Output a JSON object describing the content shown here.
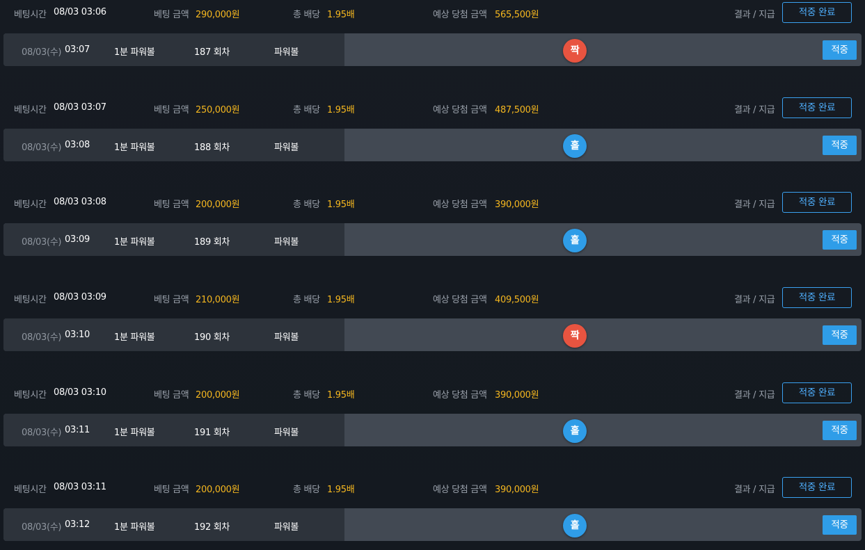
{
  "labels": {
    "bet_time": "베팅시간",
    "bet_amount": "베팅 금액",
    "total_odds": "총 배당",
    "expected_win": "예상 당첨 금액",
    "result_pay": "결과 / 지급",
    "hit_done": "적중 완료",
    "hit": "적중"
  },
  "colors": {
    "odd_ball": "#2f9de8",
    "even_ball": "#e85440",
    "accent_gold": "#f5b71f",
    "button_blue": "#2f9de8"
  },
  "bets": [
    {
      "bet_time": "08/03 03:06",
      "amount": "290,000원",
      "odds": "1.95배",
      "expected": "565,500원",
      "date": "08/03(수)",
      "time": "03:07",
      "game": "1분 파워볼",
      "round": "187 회차",
      "type": "파워볼",
      "pick": "짝",
      "pick_color": "#e85440"
    },
    {
      "bet_time": "08/03 03:07",
      "amount": "250,000원",
      "odds": "1.95배",
      "expected": "487,500원",
      "date": "08/03(수)",
      "time": "03:08",
      "game": "1분 파워볼",
      "round": "188 회차",
      "type": "파워볼",
      "pick": "홀",
      "pick_color": "#2f9de8"
    },
    {
      "bet_time": "08/03 03:08",
      "amount": "200,000원",
      "odds": "1.95배",
      "expected": "390,000원",
      "date": "08/03(수)",
      "time": "03:09",
      "game": "1분 파워볼",
      "round": "189 회차",
      "type": "파워볼",
      "pick": "홀",
      "pick_color": "#2f9de8"
    },
    {
      "bet_time": "08/03 03:09",
      "amount": "210,000원",
      "odds": "1.95배",
      "expected": "409,500원",
      "date": "08/03(수)",
      "time": "03:10",
      "game": "1분 파워볼",
      "round": "190 회차",
      "type": "파워볼",
      "pick": "짝",
      "pick_color": "#e85440"
    },
    {
      "bet_time": "08/03 03:10",
      "amount": "200,000원",
      "odds": "1.95배",
      "expected": "390,000원",
      "date": "08/03(수)",
      "time": "03:11",
      "game": "1분 파워볼",
      "round": "191 회차",
      "type": "파워볼",
      "pick": "홀",
      "pick_color": "#2f9de8"
    },
    {
      "bet_time": "08/03 03:11",
      "amount": "200,000원",
      "odds": "1.95배",
      "expected": "390,000원",
      "date": "08/03(수)",
      "time": "03:12",
      "game": "1분 파워볼",
      "round": "192 회차",
      "type": "파워볼",
      "pick": "홀",
      "pick_color": "#2f9de8"
    }
  ]
}
